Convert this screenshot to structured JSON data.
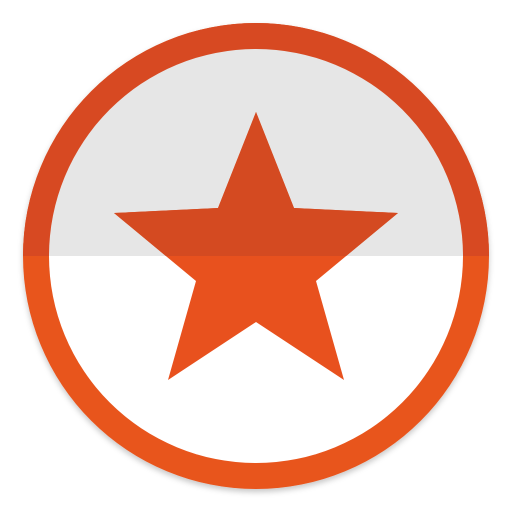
{
  "icon": {
    "name": "star-badge-icon",
    "shape": "circle-with-five-point-star",
    "colors": {
      "ring_top": "#D74A20",
      "ring_bottom": "#E8551F",
      "star_top": "#D44A21",
      "star_bottom": "#E8511E",
      "inner_top": "#E6E6E6",
      "inner_bottom": "#FFFFFF",
      "background": "#FFFFFF"
    }
  }
}
